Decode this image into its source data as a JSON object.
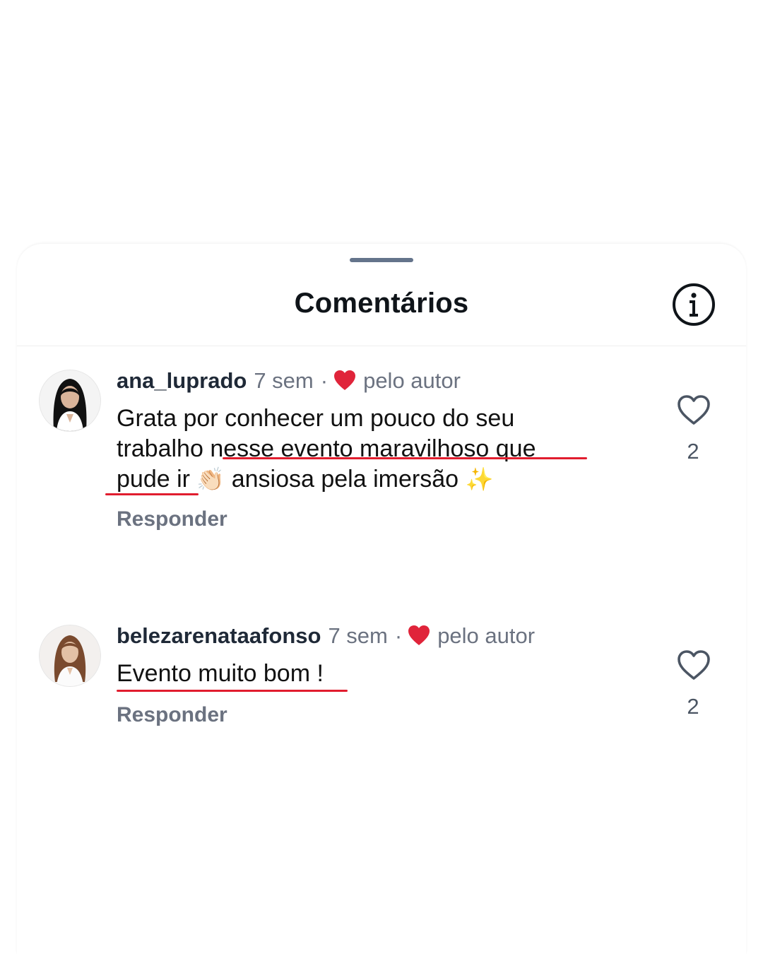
{
  "header": {
    "title": "Comentários",
    "info_icon": "info-icon"
  },
  "comments": [
    {
      "username": "ana_luprado",
      "time": "7 sem",
      "separator": "·",
      "liked_by_author_label": "pelo autor",
      "text_line1": "Grata por conhecer um pouco do seu",
      "text_line2": "trabalho nesse evento maravilhoso que",
      "text_line3_a": "pude ir",
      "emoji_clap": "👏🏻",
      "text_line3_b": "ansiosa pela imersão",
      "emoji_sparkles": "✨",
      "reply_label": "Responder",
      "like_count": "2"
    },
    {
      "username": "belezarenataafonso",
      "time": "7 sem",
      "separator": "·",
      "liked_by_author_label": "pelo autor",
      "text_line1": "Evento muito bom !",
      "reply_label": "Responder",
      "like_count": "2"
    }
  ],
  "colors": {
    "accent_heart": "#e0243a",
    "underline": "#e11d2e",
    "muted_text": "#6b7280",
    "title_text": "#0f1419"
  },
  "icons": {
    "like": "heart-outline-icon",
    "author_like": "heart-filled-icon"
  }
}
